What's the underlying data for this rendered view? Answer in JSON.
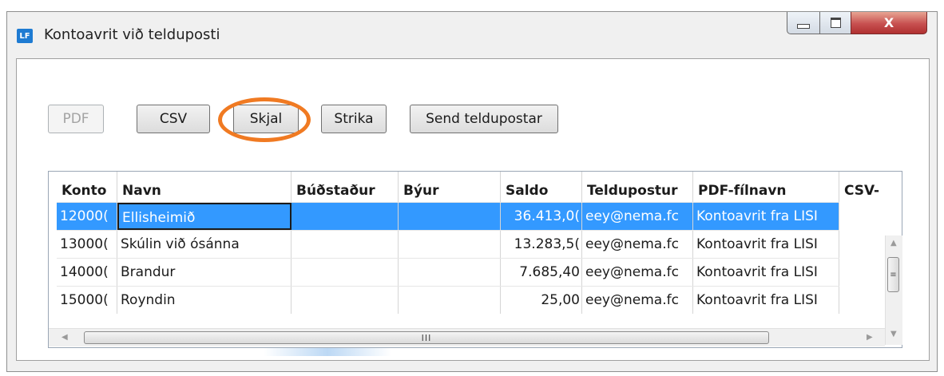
{
  "window": {
    "icon_text": "LF",
    "title": "Kontoavrit við telduposti",
    "close_glyph": "X"
  },
  "toolbar": {
    "buttons": [
      {
        "label": "PDF",
        "enabled": false
      },
      {
        "label": "CSV",
        "enabled": true
      },
      {
        "label": "Skjal",
        "enabled": true,
        "highlighted": true
      },
      {
        "label": "Strika",
        "enabled": true
      },
      {
        "label": "Send teldupostar",
        "enabled": true
      }
    ]
  },
  "grid": {
    "columns": [
      "Konto",
      "Navn",
      "Búðstaður",
      "Býur",
      "Saldo",
      "Teldupostur",
      "PDF-fílnavn",
      "CSV-"
    ],
    "rows": [
      [
        "12000(",
        "Ellisheimið",
        "",
        "",
        "36.413,0(",
        "eey@nema.fc",
        "Kontoavrit fra LISI"
      ],
      [
        "13000(",
        "Skúlin við ósánna",
        "",
        "",
        "13.283,5(",
        "eey@nema.fc",
        "Kontoavrit fra LISI"
      ],
      [
        "14000(",
        "Brandur",
        "",
        "",
        "7.685,40",
        "eey@nema.fc",
        "Kontoavrit fra LISI"
      ],
      [
        "15000(",
        "Royndin",
        "",
        "",
        "25,00",
        "eey@nema.fc",
        "Kontoavrit fra LISI"
      ]
    ],
    "selected_row": 0,
    "hscroll_grip": "III",
    "vscroll_grip": "≡"
  },
  "colors": {
    "selection": "#3399ff",
    "highlight_ring": "#f07a22"
  }
}
